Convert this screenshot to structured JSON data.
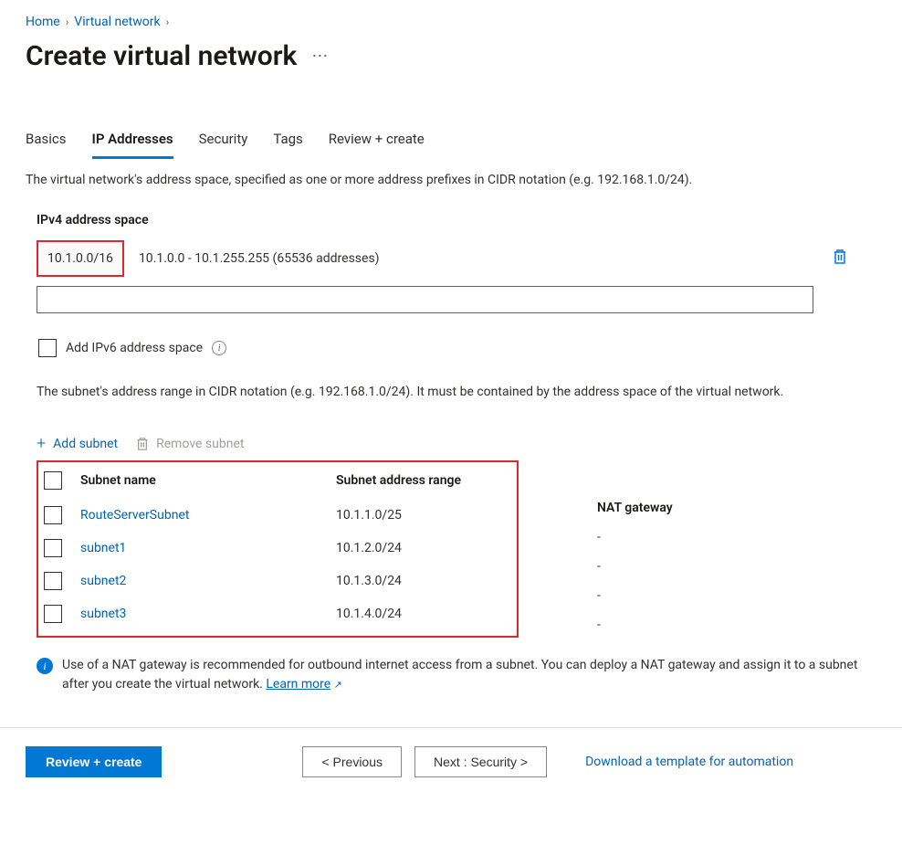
{
  "breadcrumb": {
    "home": "Home",
    "vnet": "Virtual network"
  },
  "page_title": "Create virtual network",
  "tabs": {
    "basics": "Basics",
    "ip": "IP Addresses",
    "security": "Security",
    "tags": "Tags",
    "review": "Review + create"
  },
  "description": "The virtual network's address space, specified as one or more address prefixes in CIDR notation (e.g. 192.168.1.0/24).",
  "ipv4": {
    "label": "IPv4 address space",
    "cidr": "10.1.0.0/16",
    "range": "10.1.0.0 - 10.1.255.255 (65536 addresses)"
  },
  "ipv6_label": "Add IPv6 address space",
  "subnet_description": "The subnet's address range in CIDR notation (e.g. 192.168.1.0/24). It must be contained by the address space of the virtual network.",
  "toolbar": {
    "add_subnet": "Add subnet",
    "remove_subnet": "Remove subnet"
  },
  "table": {
    "headers": {
      "name": "Subnet name",
      "range": "Subnet address range",
      "nat": "NAT gateway"
    },
    "rows": [
      {
        "name": "RouteServerSubnet",
        "range": "10.1.1.0/25",
        "nat": "-"
      },
      {
        "name": "subnet1",
        "range": "10.1.2.0/24",
        "nat": "-"
      },
      {
        "name": "subnet2",
        "range": "10.1.3.0/24",
        "nat": "-"
      },
      {
        "name": "subnet3",
        "range": "10.1.4.0/24",
        "nat": "-"
      }
    ]
  },
  "nat_banner": {
    "text": "Use of a NAT gateway is recommended for outbound internet access from a subnet. You can deploy a NAT gateway and assign it to a subnet after you create the virtual network. ",
    "learn_more": "Learn more"
  },
  "footer": {
    "review_create": "Review + create",
    "previous": "< Previous",
    "next": "Next : Security >",
    "download": "Download a template for automation"
  }
}
